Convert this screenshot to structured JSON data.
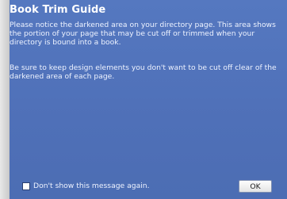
{
  "dialog": {
    "title": "Book Trim Guide",
    "paragraphs": [
      "Please notice the darkened area on your directory page. This area shows the portion of your page that may be cut off or trimmed when your directory is bound into a book.",
      "Be sure to keep design elements you don't want to be cut off clear of the darkened area of each page."
    ],
    "checkbox_label": "Don't show this message again.",
    "checkbox_checked": false,
    "ok_label": "OK"
  },
  "colors": {
    "dialog_bg": "#5578c0",
    "text": "#ffffff",
    "button_bg": "#f2f2f2"
  }
}
